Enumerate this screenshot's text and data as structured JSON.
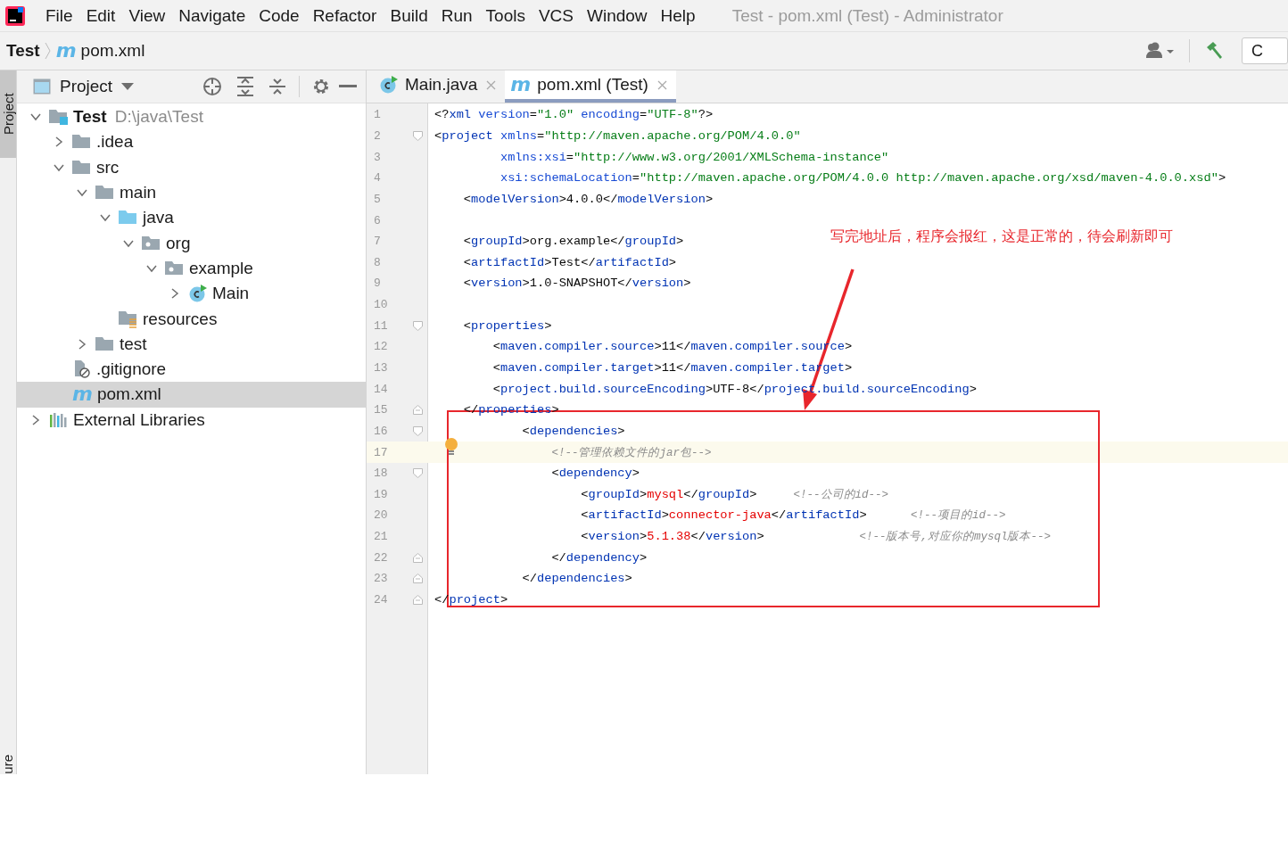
{
  "menu": [
    "File",
    "Edit",
    "View",
    "Navigate",
    "Code",
    "Refactor",
    "Build",
    "Run",
    "Tools",
    "VCS",
    "Window",
    "Help"
  ],
  "window": {
    "title": "Test - pom.xml (Test) - Administrator"
  },
  "breadcrumb": [
    {
      "label": "Test"
    },
    {
      "label": "pom.xml",
      "glyph": "m"
    }
  ],
  "run_config": {
    "label": "C"
  },
  "stripe": {
    "top": "Project",
    "bottom": "ure"
  },
  "project_panel": {
    "title": "Project"
  },
  "tree": [
    {
      "label": "Test",
      "path": "D:\\java\\Test",
      "kind": "module",
      "expanded": true,
      "selected": false,
      "children": [
        {
          "label": ".idea",
          "kind": "folder",
          "expanded": false,
          "selected": false
        },
        {
          "label": "src",
          "kind": "folder",
          "expanded": true,
          "selected": false,
          "children": [
            {
              "label": "main",
              "kind": "folder",
              "expanded": true,
              "selected": false,
              "children": [
                {
                  "label": "java",
                  "kind": "source-folder",
                  "expanded": true,
                  "selected": false,
                  "children": [
                    {
                      "label": "org",
                      "kind": "package",
                      "expanded": true,
                      "selected": false,
                      "children": [
                        {
                          "label": "example",
                          "kind": "package",
                          "expanded": true,
                          "selected": false,
                          "children": [
                            {
                              "label": "Main",
                              "kind": "class",
                              "expanded": false,
                              "selected": false
                            }
                          ]
                        }
                      ]
                    }
                  ]
                },
                {
                  "label": "resources",
                  "kind": "resources",
                  "selected": false
                }
              ]
            },
            {
              "label": "test",
              "kind": "folder",
              "expanded": false,
              "selected": false
            }
          ]
        },
        {
          "label": ".gitignore",
          "kind": "ignored",
          "selected": false
        },
        {
          "label": "pom.xml",
          "kind": "maven",
          "glyph": "m",
          "selected": true
        }
      ]
    },
    {
      "label": "External Libraries",
      "kind": "libraries",
      "expanded": false,
      "selected": false
    }
  ],
  "tabs": [
    {
      "label": "Main.java",
      "kind": "class",
      "selected": false
    },
    {
      "label": "pom.xml (Test)",
      "kind": "maven",
      "glyph": "m",
      "selected": true
    }
  ],
  "code": [
    {
      "n": "1",
      "text": "<?xml version=\"1.0\" encoding=\"UTF-8\"?>"
    },
    {
      "n": "2",
      "fold_start": true,
      "text": "<project xmlns=\"http://maven.apache.org/POM/4.0.0\""
    },
    {
      "n": "3",
      "text": "         xmlns:xsi=\"http://www.w3.org/2001/XMLSchema-instance\""
    },
    {
      "n": "4",
      "text": "         xsi:schemaLocation=\"http://maven.apache.org/POM/4.0.0 http://maven.apache.org/xsd/maven-4.0.0.xsd\">"
    },
    {
      "n": "5",
      "text": "    <modelVersion>4.0.0</modelVersion>"
    },
    {
      "n": "6"
    },
    {
      "n": "7",
      "text": "    <groupId>org.example</groupId>"
    },
    {
      "n": "8",
      "text": "    <artifactId>Test</artifactId>"
    },
    {
      "n": "9",
      "text": "    <version>1.0-SNAPSHOT</version>"
    },
    {
      "n": "10"
    },
    {
      "n": "11",
      "fold_start": true,
      "text": "    <properties>"
    },
    {
      "n": "12",
      "text": "        <maven.compiler.source>11</maven.compiler.source>"
    },
    {
      "n": "13",
      "text": "        <maven.compiler.target>11</maven.compiler.target>"
    },
    {
      "n": "14",
      "text": "        <project.build.sourceEncoding>UTF-8</project.build.sourceEncoding>"
    },
    {
      "n": "15",
      "fold_end": true,
      "text": "    </properties>"
    },
    {
      "n": "16",
      "fold_start": true,
      "text": "            <dependencies>"
    },
    {
      "n": "17",
      "current": true,
      "bulb": true,
      "text": "                <!--管理依赖文件的jar包-->"
    },
    {
      "n": "18",
      "fold_start": true,
      "text": "                <dependency>"
    },
    {
      "n": "19",
      "error": true,
      "text": "                    <groupId>mysql</groupId>",
      "comment": "     <!--公司的id-->"
    },
    {
      "n": "20",
      "error": true,
      "text": "                    <artifactId>connector-java</artifactId>",
      "comment": "      <!--项目的id-->"
    },
    {
      "n": "21",
      "error": true,
      "text": "                    <version>5.1.38</version>",
      "comment": "             <!--版本号,对应你的mysql版本-->"
    },
    {
      "n": "22",
      "fold_end": true,
      "text": "                </dependency>"
    },
    {
      "n": "23",
      "fold_end": true,
      "text": "            </dependencies>"
    },
    {
      "n": "24",
      "fold_end": true,
      "text": "</project>"
    }
  ],
  "annotation": {
    "note": "写完地址后，程序会报红，这是正常的，待会刷新即可"
  }
}
